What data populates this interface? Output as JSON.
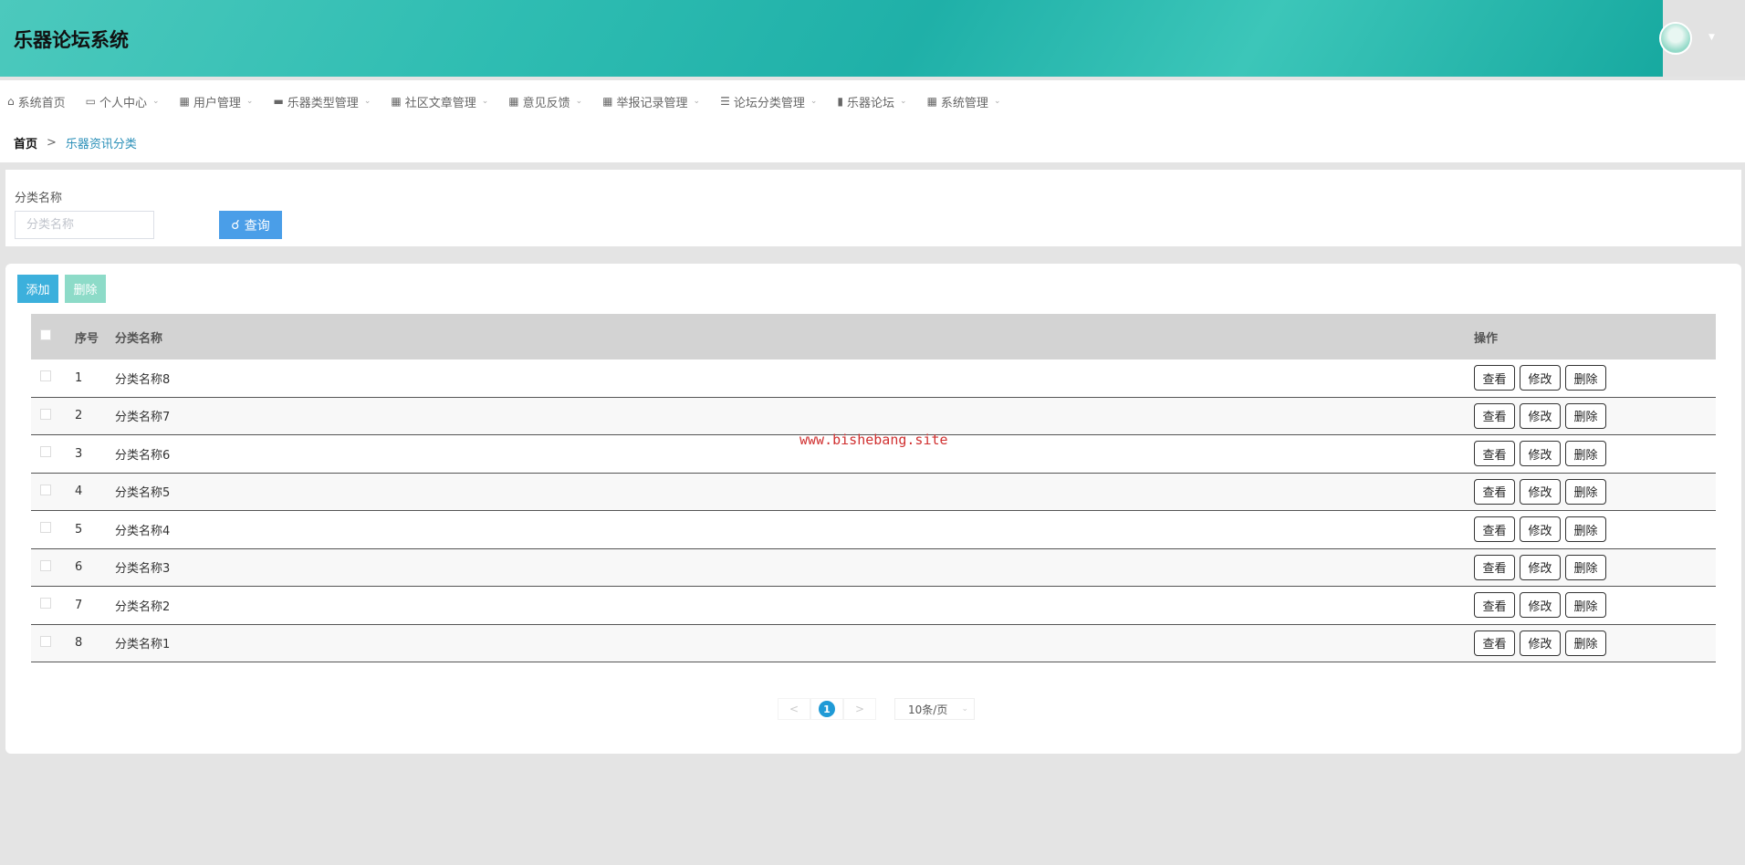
{
  "app": {
    "title": "乐器论坛系统"
  },
  "nav": [
    {
      "label": "系统首页",
      "icon": "home-icon",
      "glyph": "⌂",
      "dropdown": false
    },
    {
      "label": "个人中心",
      "icon": "calendar-icon",
      "glyph": "▭",
      "dropdown": true
    },
    {
      "label": "用户管理",
      "icon": "grid-icon",
      "glyph": "▦",
      "dropdown": true
    },
    {
      "label": "乐器类型管理",
      "icon": "comment-icon",
      "glyph": "▬",
      "dropdown": true
    },
    {
      "label": "社区文章管理",
      "icon": "grid-icon",
      "glyph": "▦",
      "dropdown": true
    },
    {
      "label": "意见反馈",
      "icon": "grid-icon",
      "glyph": "▦",
      "dropdown": true
    },
    {
      "label": "举报记录管理",
      "icon": "grid-icon",
      "glyph": "▦",
      "dropdown": true
    },
    {
      "label": "论坛分类管理",
      "icon": "list-icon",
      "glyph": "☰",
      "dropdown": true
    },
    {
      "label": "乐器论坛",
      "icon": "clipboard-icon",
      "glyph": "▮",
      "dropdown": true
    },
    {
      "label": "系统管理",
      "icon": "apps-icon",
      "glyph": "▦",
      "dropdown": true
    }
  ],
  "breadcrumb": {
    "home": "首页",
    "sep": ">",
    "current": "乐器资讯分类"
  },
  "search": {
    "label": "分类名称",
    "placeholder": "分类名称",
    "value": "",
    "button": "查询"
  },
  "toolbar": {
    "add": "添加",
    "delete": "删除"
  },
  "table": {
    "headers": {
      "index": "序号",
      "name": "分类名称",
      "ops": "操作"
    },
    "ops": {
      "view": "查看",
      "edit": "修改",
      "delete": "删除"
    },
    "rows": [
      {
        "index": "1",
        "name": "分类名称8"
      },
      {
        "index": "2",
        "name": "分类名称7"
      },
      {
        "index": "3",
        "name": "分类名称6"
      },
      {
        "index": "4",
        "name": "分类名称5"
      },
      {
        "index": "5",
        "name": "分类名称4"
      },
      {
        "index": "6",
        "name": "分类名称3"
      },
      {
        "index": "7",
        "name": "分类名称2"
      },
      {
        "index": "8",
        "name": "分类名称1"
      }
    ]
  },
  "pagination": {
    "prev": "<",
    "current": "1",
    "next": ">",
    "page_size": "10条/页"
  },
  "watermark": "www.bishebang.site"
}
